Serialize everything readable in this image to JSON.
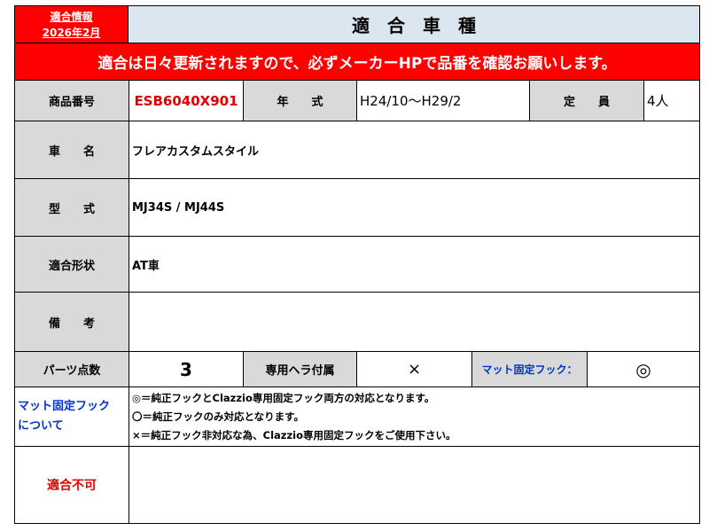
{
  "header": {
    "info_line1": "適合情報",
    "info_line2": "2026年2月",
    "title": "適　合　車　種"
  },
  "banner": {
    "text": "適合は日々更新されますので、必ずメーカーHPで品番を確認お願いします。",
    "color": "#ff0000"
  },
  "row_product": {
    "product_label": "商品番号",
    "product_value": "ESB6040X901",
    "year_label": "年　　式",
    "year_value": "H24/10〜H29/2",
    "capacity_label": "定　　員",
    "capacity_value": "4人"
  },
  "row_car": {
    "label": "車　　名",
    "value": "フレアカスタムスタイル"
  },
  "row_model": {
    "label": "型　　式",
    "value": "MJ34S / MJ44S"
  },
  "row_shape": {
    "label": "適合形状",
    "value": "AT車"
  },
  "row_note": {
    "label": "備　　考",
    "value": ""
  },
  "row_parts": {
    "parts_label": "パーツ点数",
    "parts_value": "3",
    "heel_label": "専用ヘラ付属",
    "heel_value": "×",
    "hook_label": "マット固定フック：",
    "hook_value": "◎"
  },
  "row_hook_info": {
    "label_line1": "マット固定フック",
    "label_line2": "について",
    "lines": [
      "◎＝純正フックとClazzio専用固定フック両方の対応となります。",
      "〇＝純正フックのみ対応となります。",
      "×＝純正フック非対応な為、Clazzio専用固定フックをご使用下さい。"
    ]
  },
  "row_incompatible": {
    "label": "適合不可",
    "value": ""
  },
  "colors": {
    "label_bg": "#d9d9d9",
    "title_bg": "#dce6f1",
    "accent_red": "#e00000",
    "accent_blue": "#0033cc"
  }
}
